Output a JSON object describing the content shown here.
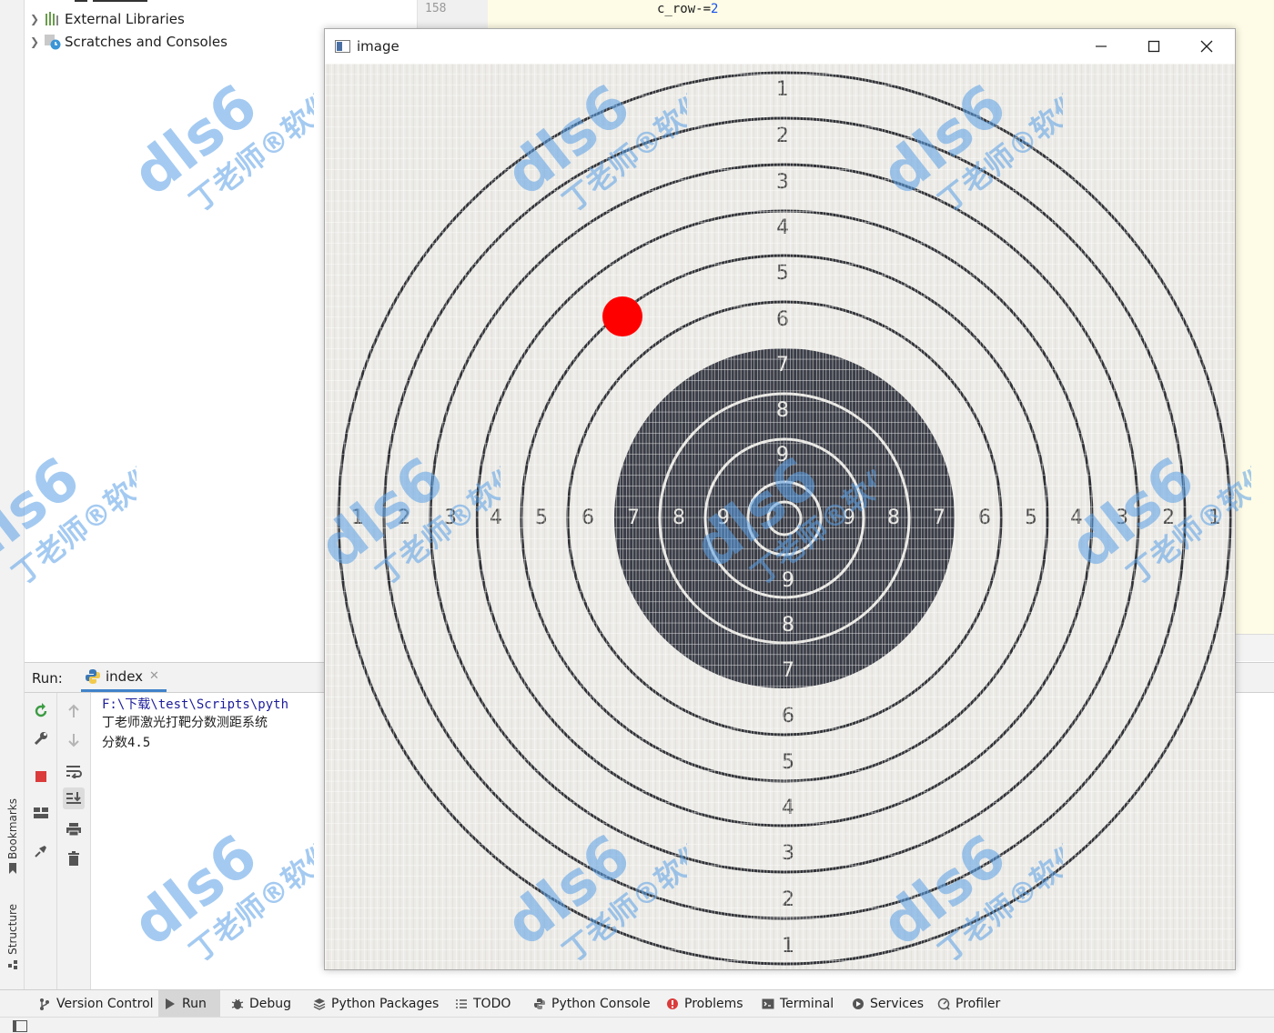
{
  "project_tree": {
    "items": [
      {
        "label": "External Libraries",
        "icon": "library-icon"
      },
      {
        "label": "Scratches and Consoles",
        "icon": "scratches-icon"
      }
    ]
  },
  "editor": {
    "line_number": "158",
    "code_var": "c_row",
    "code_op": "-=",
    "code_value": "2"
  },
  "side_stripe": {
    "bookmarks_label": "Bookmarks",
    "structure_label": "Structure"
  },
  "run_window": {
    "label": "Run:",
    "tab_label": "index",
    "console_lines": [
      "F:\\下载\\test\\Scripts\\pyth",
      "丁老师激光打靶分数测距系统",
      "分数4.5"
    ]
  },
  "image_window": {
    "title": "image"
  },
  "target": {
    "ring_numbers_top": [
      "1",
      "2",
      "3",
      "4",
      "5",
      "6",
      "7",
      "8",
      "9"
    ],
    "ring_numbers_bottom": [
      "9",
      "8",
      "7",
      "6",
      "5",
      "4",
      "3",
      "2",
      "1"
    ],
    "ring_numbers_left": [
      "1",
      "2",
      "3",
      "4",
      "5",
      "6",
      "7",
      "8",
      "9"
    ],
    "ring_numbers_right": [
      "9",
      "8",
      "7",
      "6",
      "5",
      "4",
      "3",
      "2",
      "1"
    ],
    "hit_color": "#ff0000",
    "bull_color": "#3a3d47"
  },
  "bottom_bar": {
    "items": [
      {
        "label": "Version Control",
        "icon": "version-control-icon"
      },
      {
        "label": "Run",
        "icon": "run-icon"
      },
      {
        "label": "Debug",
        "icon": "debug-icon"
      },
      {
        "label": "Python Packages",
        "icon": "packages-icon"
      },
      {
        "label": "TODO",
        "icon": "todo-icon"
      },
      {
        "label": "Python Console",
        "icon": "python-console-icon"
      },
      {
        "label": "Problems",
        "icon": "problems-icon"
      },
      {
        "label": "Terminal",
        "icon": "terminal-icon"
      },
      {
        "label": "Services",
        "icon": "services-icon"
      },
      {
        "label": "Profiler",
        "icon": "profiler-icon"
      }
    ]
  },
  "watermark": {
    "brand": "dls6",
    "caption": "丁老师®软件"
  }
}
